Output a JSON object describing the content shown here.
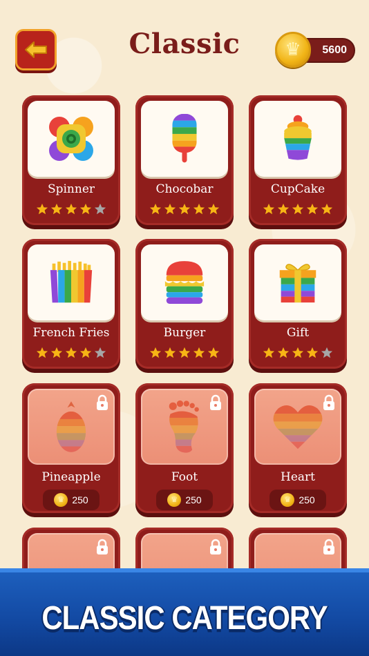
{
  "header": {
    "title": "Classic",
    "coins": "5600",
    "back_icon": "arrow-left-icon",
    "coin_icon": "crown-coin-icon"
  },
  "colors": {
    "accent": "#8f1d1b",
    "background": "#f8ebd2",
    "banner": "#1248a1",
    "star_gold": "#f7b515",
    "star_gray": "#a6a6a6"
  },
  "levels": [
    {
      "name": "Spinner",
      "stars": 4,
      "locked": false,
      "icon": "fidget-spinner-icon"
    },
    {
      "name": "Chocobar",
      "stars": 5,
      "locked": false,
      "icon": "popsicle-icon"
    },
    {
      "name": "CupCake",
      "stars": 5,
      "locked": false,
      "icon": "cupcake-icon"
    },
    {
      "name": "French Fries",
      "stars": 4,
      "locked": false,
      "icon": "french-fries-icon"
    },
    {
      "name": "Burger",
      "stars": 5,
      "locked": false,
      "icon": "burger-icon"
    },
    {
      "name": "Gift",
      "stars": 4,
      "locked": false,
      "icon": "gift-icon"
    },
    {
      "name": "Pineapple",
      "locked": true,
      "price": "250",
      "icon": "pineapple-icon"
    },
    {
      "name": "Foot",
      "locked": true,
      "price": "250",
      "icon": "foot-icon"
    },
    {
      "name": "Heart",
      "locked": true,
      "price": "250",
      "icon": "heart-icon"
    }
  ],
  "banner": {
    "text": "CLASSIC CATEGORY"
  }
}
